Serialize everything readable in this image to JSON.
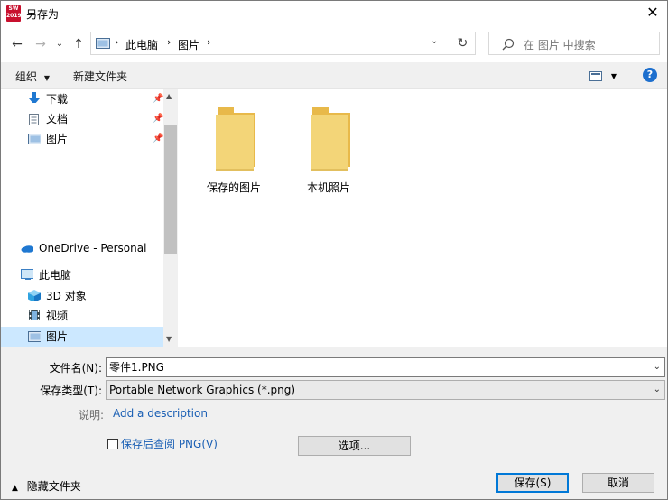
{
  "window": {
    "title": "另存为",
    "app_badge": "SW\n2019"
  },
  "nav": {
    "back": "←",
    "forward": "→",
    "recent": "⌄",
    "up": "↑"
  },
  "address": {
    "crumbs": [
      "此电脑",
      "图片"
    ]
  },
  "search": {
    "placeholder": "在 图片 中搜索"
  },
  "toolbar": {
    "organize": "组织",
    "new_folder": "新建文件夹",
    "help": "?"
  },
  "sidebar": {
    "items": [
      {
        "label": "下载",
        "icon": "download-icon",
        "pinned": true
      },
      {
        "label": "文档",
        "icon": "document-icon",
        "pinned": true
      },
      {
        "label": "图片",
        "icon": "picture-icon",
        "pinned": true
      },
      {
        "label": "OneDrive - Personal",
        "icon": "cloud-icon"
      },
      {
        "label": "此电脑",
        "icon": "computer-icon"
      },
      {
        "label": "3D 对象",
        "icon": "cube-icon"
      },
      {
        "label": "视频",
        "icon": "video-icon"
      },
      {
        "label": "图片",
        "icon": "picture-icon",
        "selected": true
      }
    ]
  },
  "folders": [
    {
      "label": "保存的图片"
    },
    {
      "label": "本机照片"
    }
  ],
  "form": {
    "filename_label": "文件名(N):",
    "filename_value": "零件1.PNG",
    "filetype_label": "保存类型(T):",
    "filetype_value": "Portable Network Graphics (*.png)",
    "desc_label": "说明:",
    "desc_link": "Add a description",
    "preview_label": "保存后查阅 PNG(V)",
    "options_button": "选项...",
    "save_button": "保存(S)",
    "cancel_button": "取消",
    "hide_folders": "隐藏文件夹"
  },
  "colors": {
    "accent": "#0078d7",
    "link": "#1a5fb4",
    "folder": "#f3d578"
  }
}
